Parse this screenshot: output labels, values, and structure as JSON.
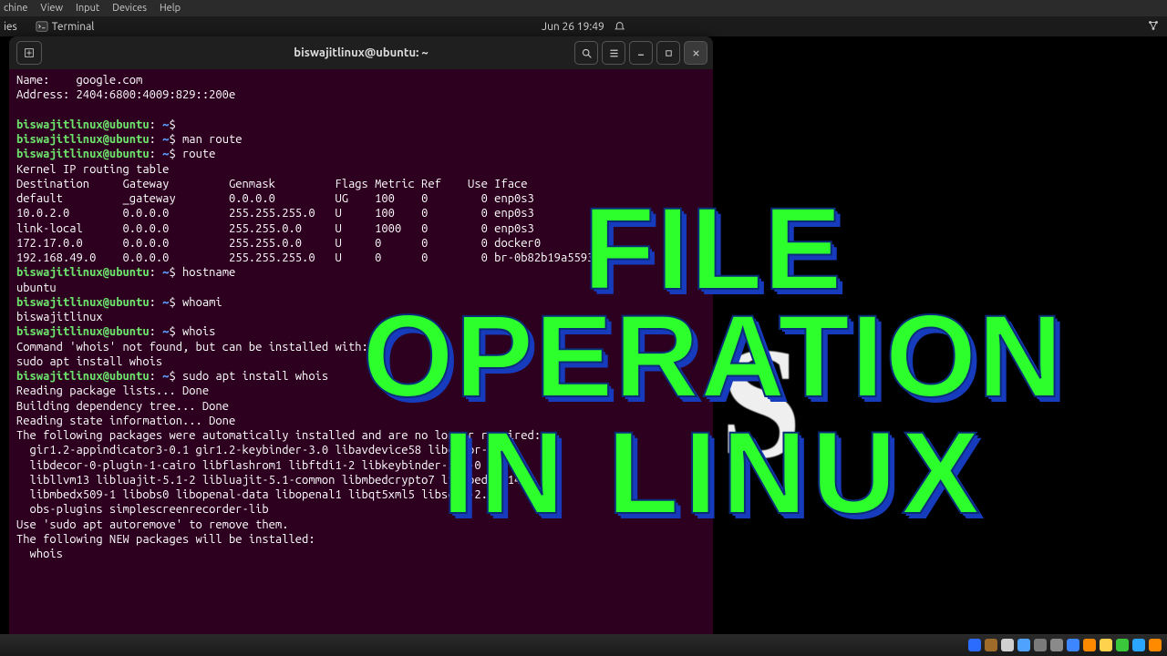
{
  "vm_menu": {
    "items": [
      "chine",
      "View",
      "Input",
      "Devices",
      "Help"
    ]
  },
  "guest_bar": {
    "activities": "ies",
    "app_label": "Terminal",
    "clock": "Jun 26  19:49"
  },
  "terminal": {
    "title": "biswajitlinux@ubuntu: ~",
    "prompt_user": "biswajitlinux@ubuntu",
    "prompt_sep": ":",
    "prompt_path": " ~",
    "prompt_end": "$ ",
    "lines": {
      "dns_name": "Name:    google.com",
      "dns_addr": "Address: 2404:6800:4009:829::200e",
      "blank": "",
      "cmd_empty": "",
      "cmd_manroute": "man route",
      "cmd_route": "route",
      "rt_title": "Kernel IP routing table",
      "rt_hdr": "Destination     Gateway         Genmask         Flags Metric Ref    Use Iface",
      "rt_r1": "default         _gateway        0.0.0.0         UG    100    0        0 enp0s3",
      "rt_r2": "10.0.2.0        0.0.0.0         255.255.255.0   U     100    0        0 enp0s3",
      "rt_r3": "link-local      0.0.0.0         255.255.0.0     U     1000   0        0 enp0s3",
      "rt_r4": "172.17.0.0      0.0.0.0         255.255.0.0     U     0      0        0 docker0",
      "rt_r5": "192.168.49.0    0.0.0.0         255.255.255.0   U     0      0        0 br-0b82b19a5593",
      "cmd_hostname": "hostname",
      "out_hostname": "ubuntu",
      "cmd_whoami": "whoami",
      "out_whoami": "biswajitlinux",
      "cmd_whois": "whois",
      "whois_nf1": "Command 'whois' not found, but can be installed with:",
      "whois_nf2": "sudo apt install whois",
      "cmd_install": "sudo apt install whois",
      "apt1": "Reading package lists... Done",
      "apt2": "Building dependency tree... Done",
      "apt3": "Reading state information... Done",
      "apt4": "The following packages were automatically installed and are no longer required:",
      "apt5": "  gir1.2-appindicator3-0.1 gir1.2-keybinder-3.0 libavdevice58 libdecor-0-0",
      "apt6": "  libdecor-0-plugin-1-cairo libflashrom1 libftdi1-2 libkeybinder-3.0-0",
      "apt7": "  libllvm13 libluajit-5.1-2 libluajit-5.1-common libmbedcrypto7 libmbedtls14",
      "apt8": "  libmbedx509-1 libobs0 libopenal-data libopenal1 libqt5xml5 libsdl2-2.0-0",
      "apt9": "  obs-plugins simplescreenrecorder-lib",
      "apt10": "Use 'sudo apt autoremove' to remove them.",
      "apt11": "The following NEW packages will be installed:",
      "apt12": "  whois"
    }
  },
  "overlay": {
    "line1": "FILE OPERATION",
    "line2": "IN LINUX"
  },
  "bg_letter": "S",
  "tray_colors": [
    "#2b6cff",
    "#9e6b2a",
    "#d0d0d0",
    "#4fa3ff",
    "#7a7a7a",
    "#8a8a8a",
    "#3c87ff",
    "#ff8a00",
    "#ffd24d",
    "#3ac73a",
    "#2aa6ff",
    "#ff8a00"
  ]
}
